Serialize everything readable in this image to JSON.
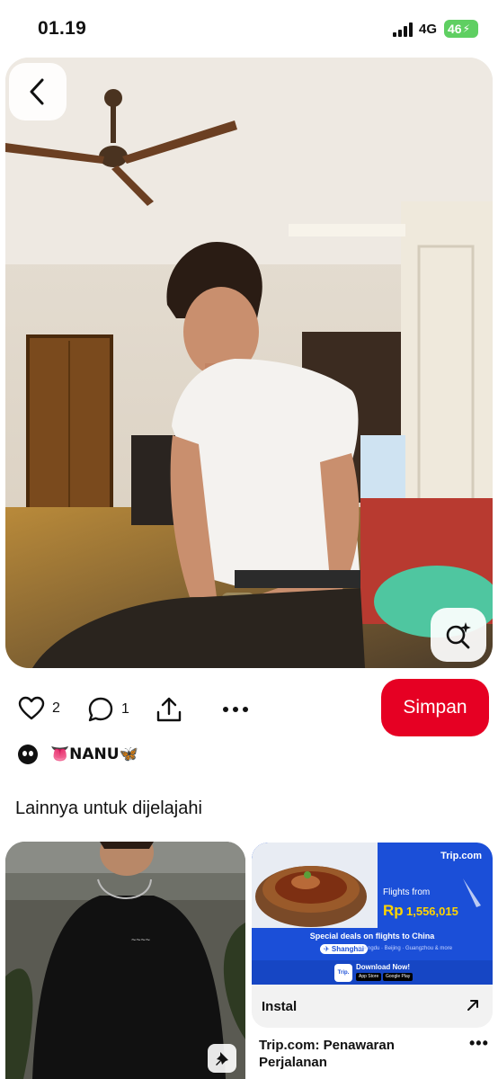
{
  "status_bar": {
    "time": "01.19",
    "network": "4G",
    "battery": "46"
  },
  "pin": {
    "image_description": "person-white-tshirt-sitting-indoors",
    "likes": "2",
    "comments": "1",
    "save_label": "Simpan",
    "author_name": "👅NANU🦋",
    "icons": [
      "back-icon",
      "lens-search-icon",
      "heart-icon",
      "comment-icon",
      "share-icon",
      "more-icon"
    ]
  },
  "explore": {
    "section_title": "Lainnya untuk dijelajahi"
  },
  "ad": {
    "brand": "Trip.com",
    "flights_from": "Flights from",
    "price_currency": "Rp",
    "price": "1,556,015",
    "special": "Special deals on flights to China",
    "chip": "✈ Shanghai",
    "route": "Chengdu · Beijing · Guangzhou & more",
    "logo": "Trip.",
    "download": "Download Now!",
    "app_store": "App Store",
    "google_play": "Google Play",
    "install_label": "Instal",
    "title": "Trip.com: Penawaran Perjalanan",
    "more": "•••"
  },
  "colors": {
    "save_button": "#e60023",
    "ad_blue": "#1b4fd8",
    "battery_green": "#5fcf62"
  }
}
